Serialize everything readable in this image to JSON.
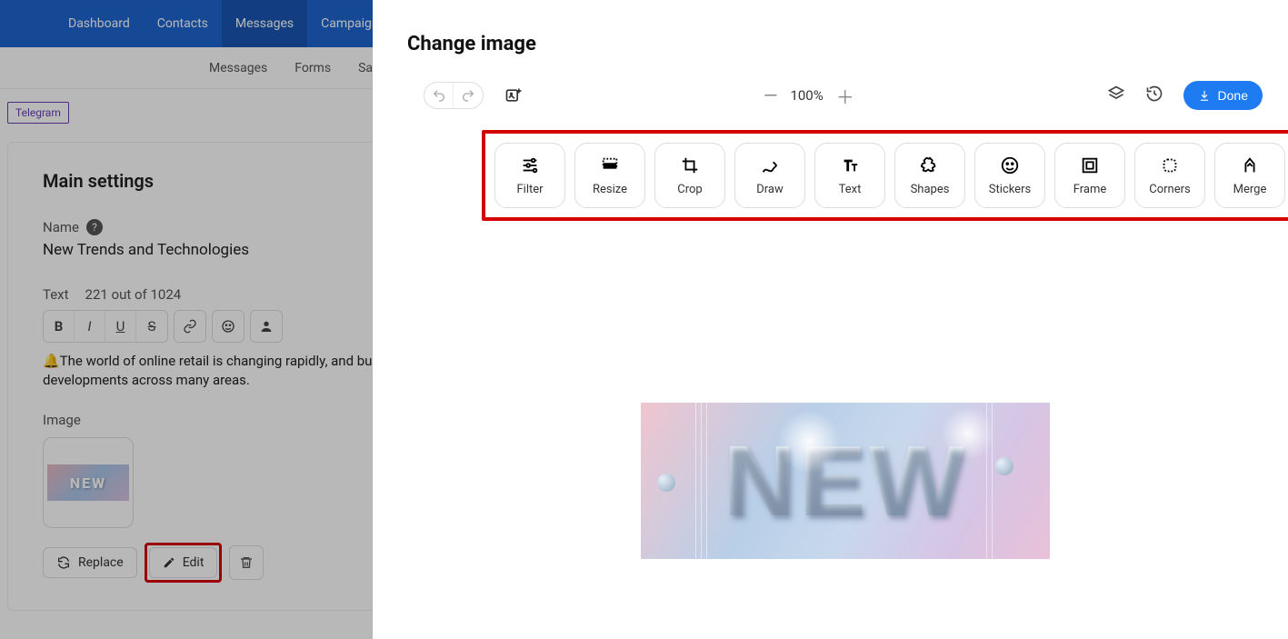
{
  "nav": {
    "dashboard": "Dashboard",
    "contacts": "Contacts",
    "messages": "Messages",
    "campaigns": "Campaigns"
  },
  "subnav": {
    "messages": "Messages",
    "forms": "Forms",
    "saved": "Saved"
  },
  "chip": "Telegram",
  "settings": {
    "title": "Main settings",
    "name_label": "Name",
    "name_value": "New Trends and Technologies",
    "text_label": "Text",
    "text_counter": "221 out of 1024",
    "body": "🔔The world of online retail is changing rapidly, and businesses that want to remain competitive must stay up-to-date with the latest trends and technologies. In 2024, we expect significant developments across many areas.",
    "image_label": "Image",
    "thumb_text": "NEW",
    "replace": "Replace",
    "edit": "Edit"
  },
  "editor": {
    "title": "Change image",
    "zoom": "100%",
    "done": "Done",
    "tools": {
      "filter": "Filter",
      "resize": "Resize",
      "crop": "Crop",
      "draw": "Draw",
      "text": "Text",
      "shapes": "Shapes",
      "stickers": "Stickers",
      "frame": "Frame",
      "corners": "Corners",
      "merge": "Merge"
    },
    "canvas_text": "NEW"
  }
}
